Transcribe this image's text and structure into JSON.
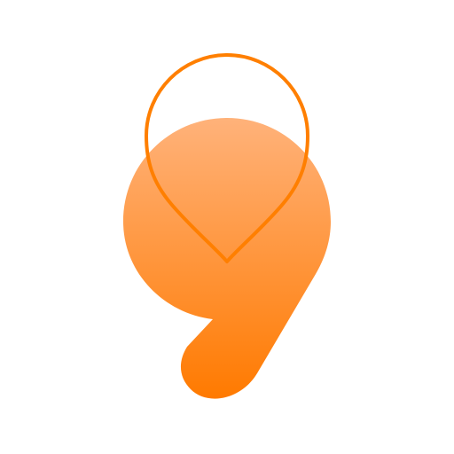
{
  "logo": {
    "name": "app-logo",
    "icons": [
      "nine-shape-icon",
      "map-pin-outline-icon"
    ],
    "colors": {
      "gradient_top": "#FFB27A",
      "gradient_bottom": "#FF7A00",
      "pin_stroke": "#FF7F00",
      "background": "#FFFFFF"
    }
  }
}
